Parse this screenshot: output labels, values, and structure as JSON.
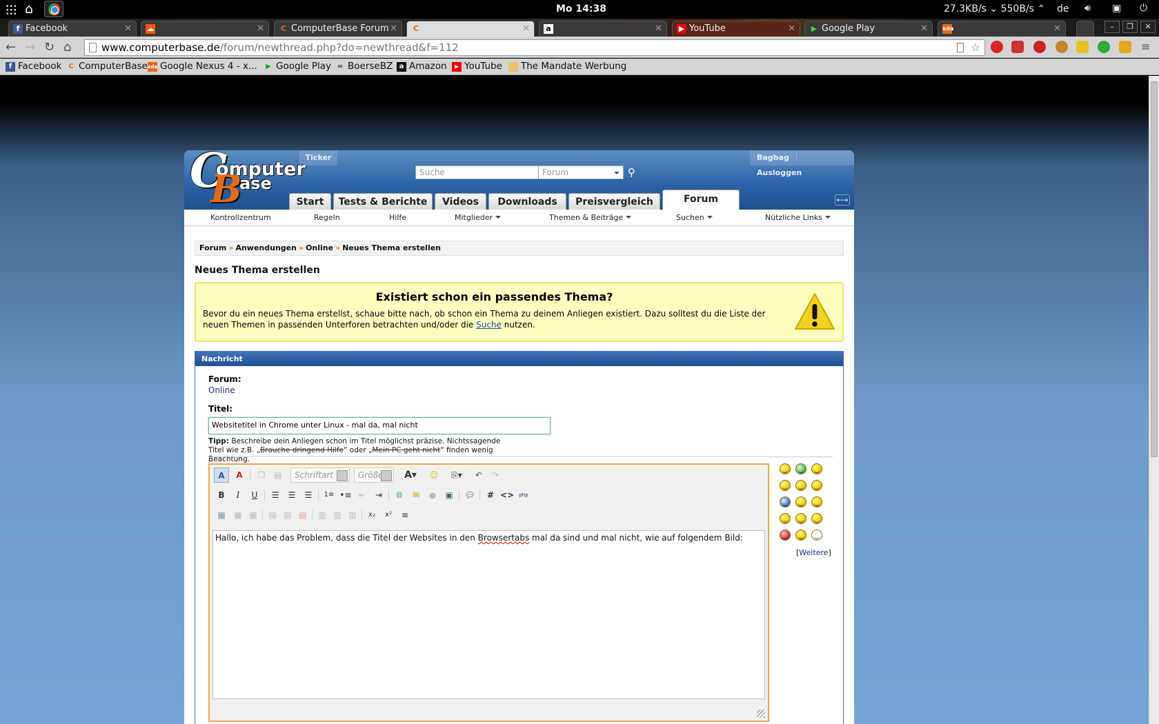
{
  "topbar": {
    "clock": "Mo 14:38",
    "net_down": "27.3KB/s",
    "net_up": "550B/s",
    "lang": "de"
  },
  "tabs": [
    {
      "title": "Facebook",
      "icon": "facebook-icon"
    },
    {
      "title": "",
      "icon": "soundcloud-icon"
    },
    {
      "title": "ComputerBase Forum",
      "icon": "computerbase-icon"
    },
    {
      "title": "",
      "icon": "computerbase-icon"
    },
    {
      "title": "",
      "icon": "amazon-icon"
    },
    {
      "title": "YouTube",
      "icon": "youtube-icon"
    },
    {
      "title": "Google Play",
      "icon": "google-play-icon"
    },
    {
      "title": "",
      "icon": "xda-icon"
    }
  ],
  "omnibox": {
    "host": "www.computerbase.de",
    "path": "/forum/newthread.php?do=newthread&f=112"
  },
  "bookmarks": [
    {
      "label": "Facebook",
      "icon": "facebook-icon"
    },
    {
      "label": "ComputerBase",
      "icon": "computerbase-icon"
    },
    {
      "label": "Google Nexus 4 - x...",
      "icon": "xda-icon"
    },
    {
      "label": "Google Play",
      "icon": "google-play-icon"
    },
    {
      "label": "BoerseBZ",
      "icon": "boerse-icon"
    },
    {
      "label": "Amazon",
      "icon": "amazon-icon"
    },
    {
      "label": "YouTube",
      "icon": "youtube-icon"
    },
    {
      "label": "The Mandate Werbung",
      "icon": "folder-icon"
    }
  ],
  "site": {
    "ticker": "Ticker",
    "search_placeholder": "Suche",
    "search_scope": "Forum",
    "user": "Bagbag",
    "logout": "Ausloggen",
    "nav": [
      "Start",
      "Tests & Berichte",
      "Videos",
      "Downloads",
      "Preisvergleich",
      "Forum"
    ],
    "subnav": [
      "Kontrollzentrum",
      "Regeln",
      "Hilfe",
      "Mitglieder",
      "Themen & Beiträge",
      "Suchen",
      "Nützliche Links"
    ],
    "breadcrumb": [
      "Forum",
      "Anwendungen",
      "Online",
      "Neues Thema erstellen"
    ],
    "breadcrumb_sep": "»",
    "page_title": "Neues Thema erstellen",
    "warning": {
      "title": "Existiert schon ein passendes Thema?",
      "text_before": "Bevor du ein neues Thema erstellst, schaue bitte nach, ob schon ein Thema zu deinem Anliegen existiert. Dazu solltest du die Liste der neuen Themen in passenden Unterforen betrachten und/oder die ",
      "link": "Suche",
      "text_after": " nutzen."
    },
    "panel": {
      "header": "Nachricht",
      "forum_label": "Forum:",
      "forum_value": "Online",
      "title_label": "Titel:",
      "title_value": "Websitetitel in Chrome unter Linux - mal da, mal nicht",
      "tip_label": "Tipp:",
      "tip_text1": " Beschreibe dein Anliegen schon im Titel möglichst präzise. Nichtssagende Titel wie z.B. „",
      "tip_strike1": "Brauche dringend Hilfe",
      "tip_text2": "“ oder „",
      "tip_strike2": "Mein PC geht nicht",
      "tip_text3": "“ finden wenig Beachtung."
    },
    "editor": {
      "font_combo": "Schriftart",
      "size_combo": "Größe",
      "text_before": "Hallo, ich habe das Problem, dass die Titel der Websites in den ",
      "text_misspelled": "Browsertabs",
      "text_after": " mal da sind und mal nicht, wie auf folgendem Bild:"
    },
    "smilies_more": "Weitere"
  }
}
